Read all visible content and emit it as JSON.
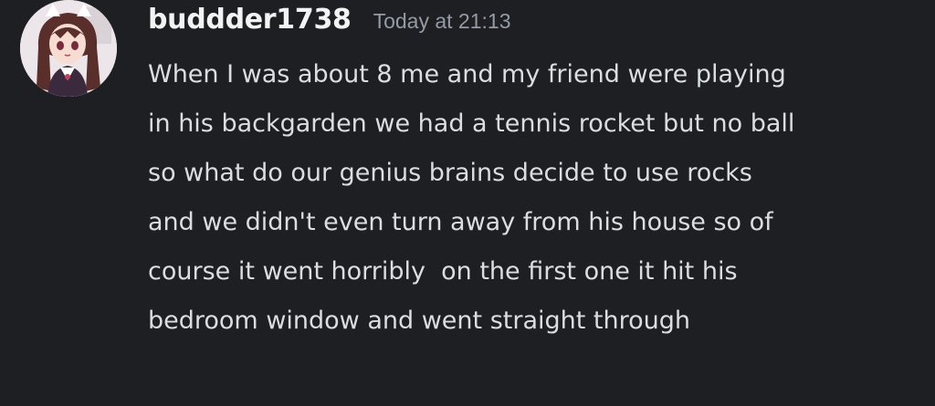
{
  "message": {
    "author": "buddder1738",
    "timestamp": "Today at 21:13",
    "lines": [
      "When I was about 8 me and my friend were playing",
      "in his backgarden we had a tennis rocket but no ball",
      "so what do our genius brains decide to use rocks",
      "and we didn't even turn away from his house so of",
      "course it went horribly  on the first one it hit his",
      "bedroom window and went straight through"
    ]
  },
  "colors": {
    "background": "#1e1f22",
    "username": "#f2f3f5",
    "timestamp": "#949ba4",
    "text": "#dbdee1"
  },
  "icons": {
    "avatar": "anime-girl-avatar"
  }
}
